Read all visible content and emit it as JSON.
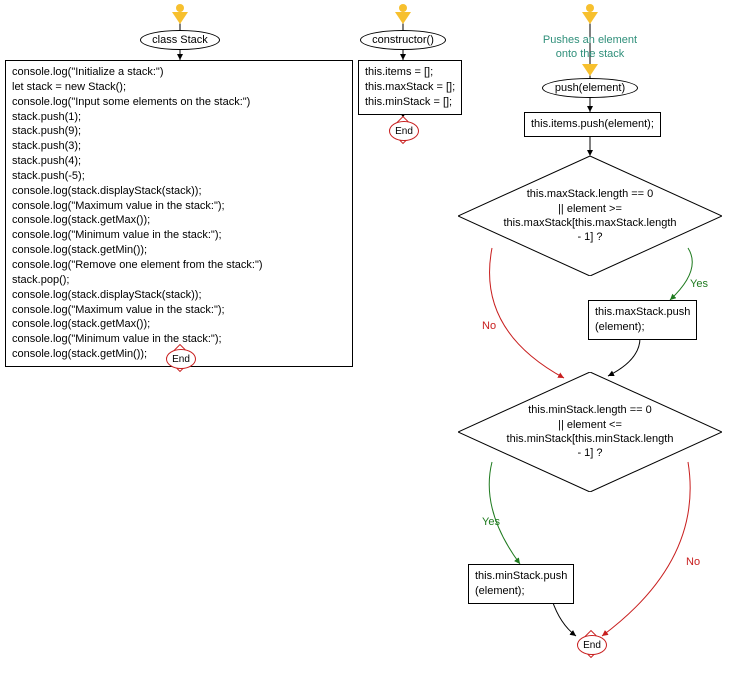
{
  "col1": {
    "title": "class Stack",
    "body": "console.log(\"Initialize a stack:\")\nlet stack = new Stack();\nconsole.log(\"Input some elements on the stack:\")\nstack.push(1);\nstack.push(9);\nstack.push(3);\nstack.push(4);\nstack.push(-5);\nconsole.log(stack.displayStack(stack));\nconsole.log(\"Maximum value in the stack:\");\nconsole.log(stack.getMax());\nconsole.log(\"Minimum value in the stack:\");\nconsole.log(stack.getMin());\nconsole.log(\"Remove one element from the stack:\")\nstack.pop();\nconsole.log(stack.displayStack(stack));\nconsole.log(\"Maximum value in the stack:\");\nconsole.log(stack.getMax());\nconsole.log(\"Minimum value in the stack:\");\nconsole.log(stack.getMin());",
    "end": "End"
  },
  "col2": {
    "title": "constructor()",
    "body": "this.items = [];\nthis.maxStack = [];\nthis.minStack = [];",
    "end": "End"
  },
  "col3": {
    "comment": "Pushes an element\nonto the stack",
    "title": "push(element)",
    "step1": "this.items.push(element);",
    "decision1": "this.maxStack.length == 0\n|| element >=\nthis.maxStack[this.maxStack.length\n- 1] ?",
    "action1": "this.maxStack.push\n(element);",
    "decision2": "this.minStack.length == 0\n|| element <=\nthis.minStack[this.minStack.length\n- 1] ?",
    "action2": "this.minStack.push\n(element);",
    "end": "End",
    "yes": "Yes",
    "no": "No"
  }
}
